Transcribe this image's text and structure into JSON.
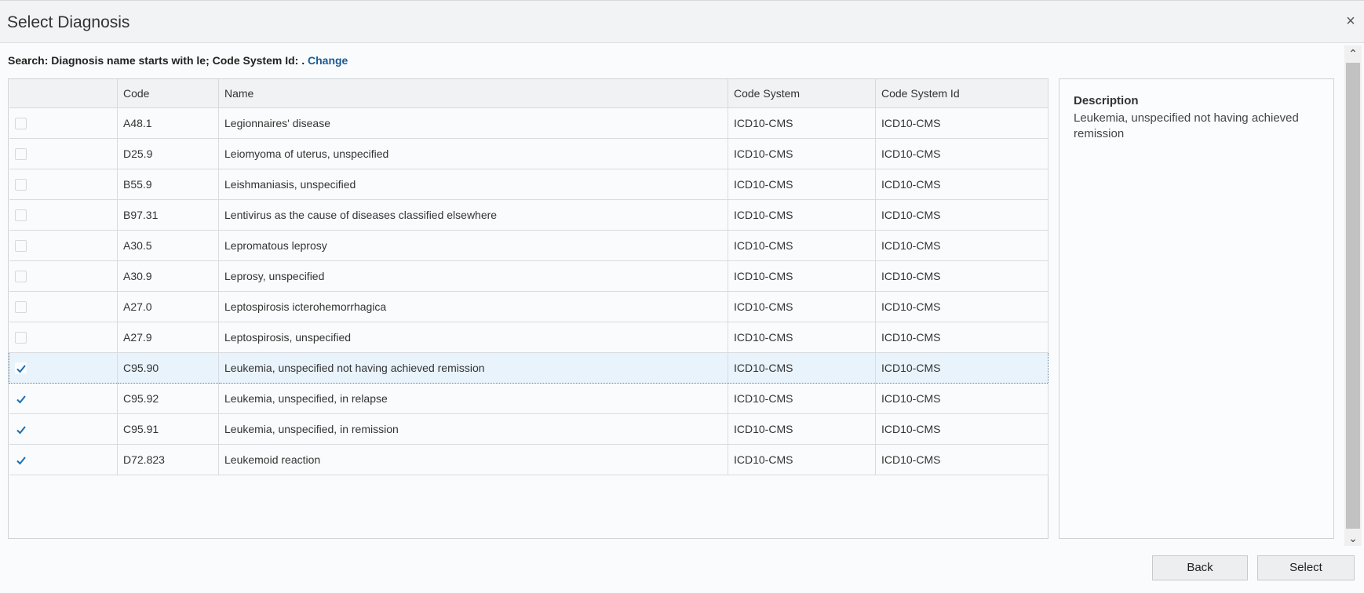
{
  "dialog": {
    "title": "Select Diagnosis",
    "close_label": "×"
  },
  "search": {
    "prefix": "Search:  Diagnosis name  starts with le; Code System Id: . ",
    "change_label": "Change"
  },
  "table": {
    "columns": [
      "",
      "Code",
      "Name",
      "Code System",
      "Code System Id"
    ],
    "rows": [
      {
        "checked": false,
        "code": "A48.1",
        "name": "Legionnaires' disease",
        "code_system": "ICD10-CMS",
        "code_system_id": "ICD10-CMS"
      },
      {
        "checked": false,
        "code": "D25.9",
        "name": "Leiomyoma of uterus, unspecified",
        "code_system": "ICD10-CMS",
        "code_system_id": "ICD10-CMS"
      },
      {
        "checked": false,
        "code": "B55.9",
        "name": "Leishmaniasis, unspecified",
        "code_system": "ICD10-CMS",
        "code_system_id": "ICD10-CMS"
      },
      {
        "checked": false,
        "code": "B97.31",
        "name": "Lentivirus as the cause of diseases classified elsewhere",
        "code_system": "ICD10-CMS",
        "code_system_id": "ICD10-CMS"
      },
      {
        "checked": false,
        "code": "A30.5",
        "name": "Lepromatous leprosy",
        "code_system": "ICD10-CMS",
        "code_system_id": "ICD10-CMS"
      },
      {
        "checked": false,
        "code": "A30.9",
        "name": "Leprosy, unspecified",
        "code_system": "ICD10-CMS",
        "code_system_id": "ICD10-CMS"
      },
      {
        "checked": false,
        "code": "A27.0",
        "name": "Leptospirosis icterohemorrhagica",
        "code_system": "ICD10-CMS",
        "code_system_id": "ICD10-CMS"
      },
      {
        "checked": false,
        "code": "A27.9",
        "name": "Leptospirosis, unspecified",
        "code_system": "ICD10-CMS",
        "code_system_id": "ICD10-CMS"
      },
      {
        "checked": true,
        "code": "C95.90",
        "name": "Leukemia, unspecified not having achieved remission",
        "code_system": "ICD10-CMS",
        "code_system_id": "ICD10-CMS",
        "selected": true
      },
      {
        "checked": true,
        "code": "C95.92",
        "name": "Leukemia, unspecified, in relapse",
        "code_system": "ICD10-CMS",
        "code_system_id": "ICD10-CMS"
      },
      {
        "checked": true,
        "code": "C95.91",
        "name": "Leukemia, unspecified, in remission",
        "code_system": "ICD10-CMS",
        "code_system_id": "ICD10-CMS"
      },
      {
        "checked": true,
        "code": "D72.823",
        "name": "Leukemoid reaction",
        "code_system": "ICD10-CMS",
        "code_system_id": "ICD10-CMS"
      }
    ]
  },
  "description": {
    "title": "Description",
    "text": "Leukemia, unspecified not having achieved remission"
  },
  "footer": {
    "back_label": "Back",
    "select_label": "Select"
  },
  "colors": {
    "accent": "#1a6fb3",
    "selected_row": "#e9f3fb"
  }
}
